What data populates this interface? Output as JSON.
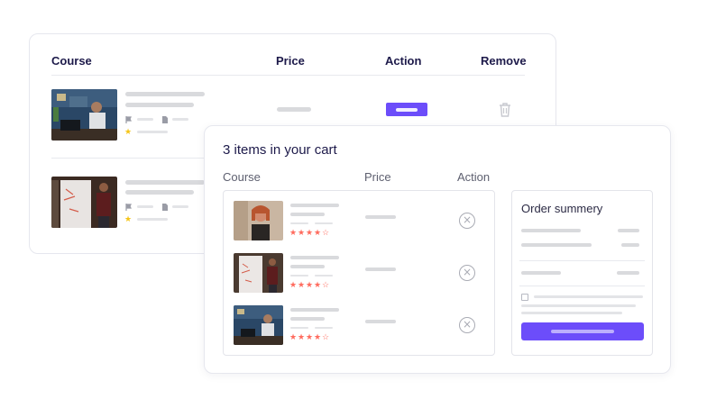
{
  "back_table": {
    "headers": {
      "course": "Course",
      "price": "Price",
      "action": "Action",
      "remove": "Remove"
    },
    "icons": [
      "flag-icon",
      "file-icon",
      "star-icon",
      "trash-icon"
    ]
  },
  "cart": {
    "title": "3 items in your cart",
    "headers": {
      "course": "Course",
      "price": "Price",
      "action": "Action"
    },
    "item_count": 3,
    "rating_stars": 4.5,
    "remove_icon": "x-circle-icon"
  },
  "order_summary": {
    "title": "Order summery"
  },
  "colors": {
    "accent": "#6c4dfa",
    "star_orange": "#ff6b5e",
    "star_yellow": "#f5c518",
    "placeholder": "#d9dadd",
    "heading": "#1d1a4a"
  }
}
